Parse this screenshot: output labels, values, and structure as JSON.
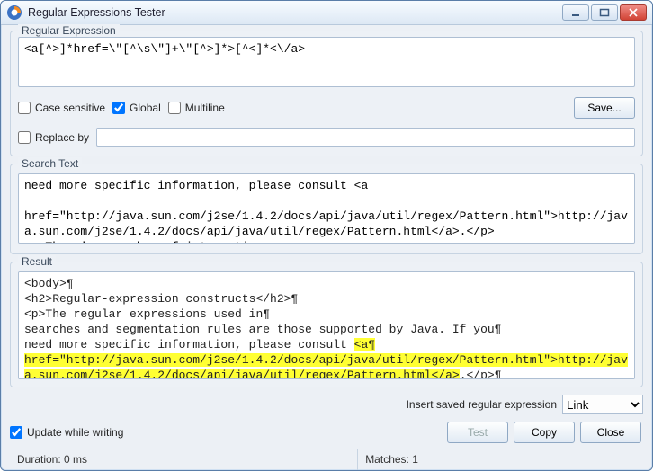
{
  "window": {
    "title": "Regular Expressions Tester"
  },
  "regex": {
    "legend": "Regular Expression",
    "value": "<a[^>]*href=\\\"[^\\s\\\"]+\\\"[^>]*>[^<]*<\\/a>",
    "options": {
      "case_sensitive_label": "Case sensitive",
      "case_sensitive_checked": false,
      "global_label": "Global",
      "global_checked": true,
      "multiline_label": "Multiline",
      "multiline_checked": false
    },
    "save_label": "Save...",
    "replace_by_label": "Replace by",
    "replace_by_checked": false,
    "replace_value": ""
  },
  "search": {
    "legend": "Search Text",
    "value": "need more specific information, please consult <a\n href=\"http://java.sun.com/j2se/1.4.2/docs/api/java/util/regex/Pattern.html\">http://java.sun.com/j2se/1.4.2/docs/api/java/util/regex/Pattern.html</a>.</p>\n<p>There's a number of interactive\ntools available to develop and test regular expressions. The following"
  },
  "result": {
    "legend": "Result",
    "pre1": "<body>¶\n<h2>Regular-expression constructs</h2>¶\n<p>The regular expressions used in¶\nsearches and segmentation rules are those supported by Java. If you¶\nneed more specific information, please consult ",
    "match": "<a¶\nhref=\"http://java.sun.com/j2se/1.4.2/docs/api/java/util/regex/Pattern.html\">http://java.sun.com/j2se/1.4.2/docs/api/java/util/regex/Pattern.html</a>",
    "post1": ".</p>¶\n<p>There's a number of interactive¶"
  },
  "footer": {
    "insert_label": "Insert saved regular expression",
    "insert_selected": "Link",
    "update_while_writing_label": "Update while writing",
    "update_while_writing_checked": true,
    "buttons": {
      "test": "Test",
      "copy": "Copy",
      "close": "Close"
    }
  },
  "status": {
    "duration": "Duration: 0 ms",
    "matches": "Matches: 1"
  }
}
